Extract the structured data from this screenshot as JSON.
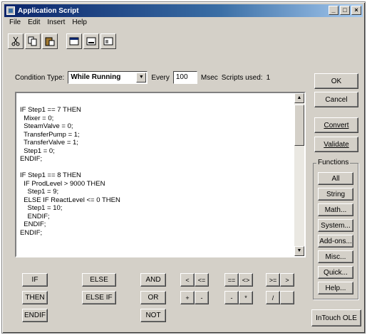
{
  "window": {
    "title": "Application Script",
    "controls": [
      "_",
      "□",
      "×"
    ]
  },
  "menu": [
    "File",
    "Edit",
    "Insert",
    "Help"
  ],
  "toolbar": [
    "cut-icon",
    "copy-icon",
    "paste-icon",
    "window-icon",
    "minimize-pane-icon",
    "maximize-pane-icon"
  ],
  "condition": {
    "type_label": "Condition Type:",
    "type_value": "While Running",
    "every_label": "Every",
    "every_value": "100",
    "msec_label": "Msec",
    "scripts_used_label": "Scripts used:",
    "scripts_used_value": "1"
  },
  "code": "IF Step1 == 7 THEN\n  Mixer = 0;\n  SteamValve = 0;\n  TransferPump = 1;\n  TransferValve = 1;\n  Step1 = 0;\nENDIF;\n\nIF Step1 == 8 THEN\n  IF ProdLevel > 9000 THEN\n    Step1 = 9;\n  ELSE IF ReactLevel <= 0 THEN\n    Step1 = 10;\n    ENDIF;\n  ENDIF;\nENDIF;",
  "buttons": {
    "ok": "OK",
    "cancel": "Cancel",
    "convert": "Convert",
    "validate": "Validate"
  },
  "functions": {
    "label": "Functions",
    "items": [
      "All",
      "String",
      "Math...",
      "System...",
      "Add-ons...",
      "Misc...",
      "Quick...",
      "Help..."
    ]
  },
  "keywords": {
    "if": "IF",
    "then": "THEN",
    "endif": "ENDIF",
    "else": "ELSE",
    "elseif": "ELSE IF",
    "and": "AND",
    "or": "OR",
    "not": "NOT"
  },
  "operators": {
    "row1": [
      "<",
      "<=",
      "==",
      "<>",
      ">=",
      ">"
    ],
    "row2": [
      "+",
      "-",
      "-",
      "*",
      "/",
      ""
    ]
  },
  "intouch_ole": "InTouch OLE"
}
